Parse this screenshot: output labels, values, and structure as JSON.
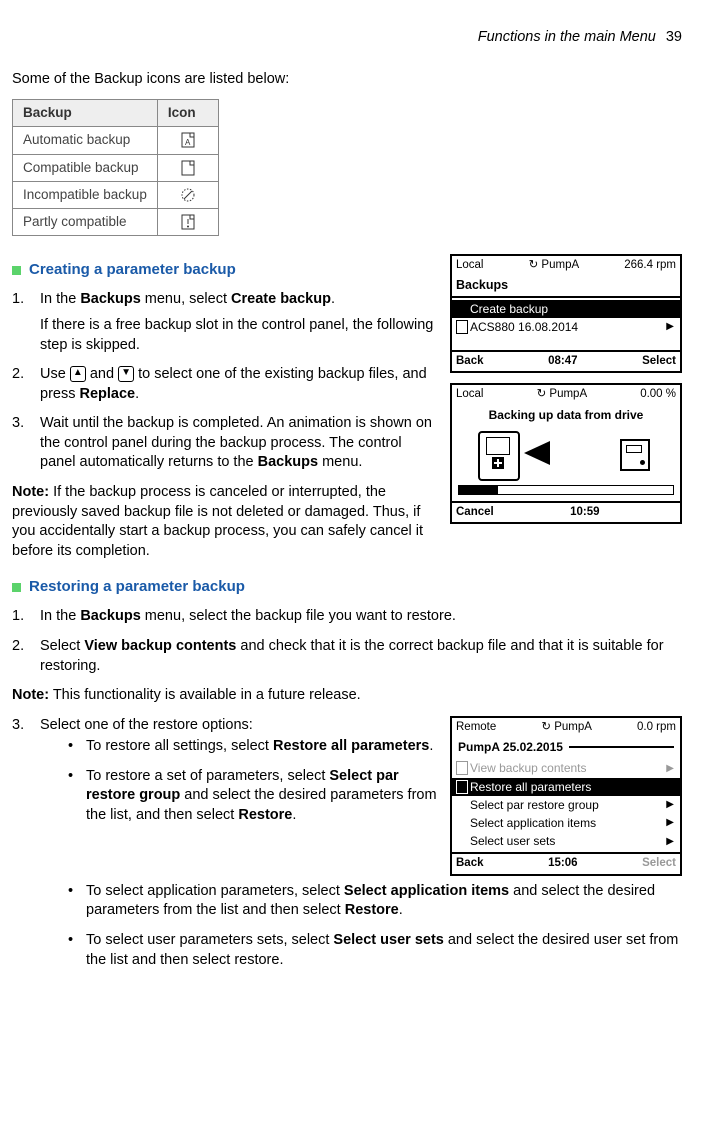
{
  "header": {
    "title": "Functions in the main Menu",
    "page": "39"
  },
  "intro": "Some of the Backup icons are listed below:",
  "icon_table": {
    "headers": [
      "Backup",
      "Icon"
    ],
    "rows": [
      {
        "label": "Automatic backup",
        "icon": "doc-a-icon"
      },
      {
        "label": "Compatible backup",
        "icon": "doc-blank-icon"
      },
      {
        "label": "Incompatible backup",
        "icon": "doc-crossed-icon"
      },
      {
        "label": "Partly compatible",
        "icon": "doc-exclaim-icon"
      }
    ]
  },
  "section1": {
    "title": "Creating a parameter backup",
    "step1_a": "In the ",
    "step1_b": "Backups",
    "step1_c": " menu, select ",
    "step1_d": "Create backup",
    "step1_e": ".",
    "step1_p2": "If there is a free backup slot in the control panel, the following step is skipped.",
    "step2_a": "Use ",
    "step2_b": " and ",
    "step2_c": " to select one of the existing backup files, and press ",
    "step2_d": "Replace",
    "step2_e": ".",
    "step3_a": "Wait until the backup is completed. An animation is shown on the control panel during the backup process. The control panel automatically returns to the ",
    "step3_b": "Backups",
    "step3_c": " menu.",
    "note1_a": "Note:",
    "note1_b": " If the backup process is canceled or interrupted, the previously saved backup file is not deleted or damaged. Thus, if you accidentally start a backup process, you can safely cancel it before its completion."
  },
  "lcd1": {
    "top_left": "Local",
    "top_mid": "PumpA",
    "top_right": "266.4 rpm",
    "title": "Backups",
    "items": [
      {
        "label": "Create backup",
        "selected": true,
        "icon": false,
        "arrow": false
      },
      {
        "label": "ACS880 16.08.2014",
        "selected": false,
        "icon": true,
        "arrow": true
      }
    ],
    "bot_left": "Back",
    "bot_mid": "08:47",
    "bot_right": "Select"
  },
  "lcd2": {
    "top_left": "Local",
    "top_mid": "PumpA",
    "top_right": "0.00 %",
    "msg": "Backing up data from drive",
    "bot_left": "Cancel",
    "bot_mid": "10:59",
    "bot_right": ""
  },
  "section2": {
    "title": "Restoring a parameter backup",
    "step1_a": "In the ",
    "step1_b": "Backups",
    "step1_c": " menu, select the backup file you want to restore.",
    "step2_a": "Select ",
    "step2_b": "View backup contents",
    "step2_c": " and check that it is the correct backup file and that it is suitable for restoring.",
    "note2_a": "Note:",
    "note2_b": " This functionality is available in a future release.",
    "step3": "Select one of the restore options:",
    "opts": {
      "o1_a": "To restore all settings, select ",
      "o1_b": "Restore all parameters",
      "o1_c": ".",
      "o2_a": "To restore a set of parameters, select ",
      "o2_b": "Select par restore group",
      "o2_c": " and select the desired parameters from the list, and then select ",
      "o2_d": "Restore",
      "o2_e": ".",
      "o3_a": "To select application parameters, select ",
      "o3_b": "Select application items",
      "o3_c": " and select the desired parameters from the list and then select ",
      "o3_d": "Restore",
      "o3_e": ".",
      "o4_a": "To select user parameters sets, select ",
      "o4_b": "Select user sets",
      "o4_c": " and select the desired user set from the list and then select restore."
    }
  },
  "lcd3": {
    "top_left": "Remote",
    "top_mid": "PumpA",
    "top_right": "0.0 rpm",
    "title": "PumpA 25.02.2015",
    "items": [
      {
        "label": "View backup contents",
        "selected": false,
        "icon": true,
        "arrow": true,
        "grey": true
      },
      {
        "label": "Restore all parameters",
        "selected": true,
        "icon": true,
        "arrow": false
      },
      {
        "label": "Select par restore group",
        "selected": false,
        "icon": false,
        "arrow": true
      },
      {
        "label": "Select application items",
        "selected": false,
        "icon": false,
        "arrow": true
      },
      {
        "label": "Select user sets",
        "selected": false,
        "icon": false,
        "arrow": true
      }
    ],
    "bot_left": "Back",
    "bot_mid": "15:06",
    "bot_right": "Select"
  },
  "chart_data": {
    "type": "table",
    "title": "Backup icons",
    "columns": [
      "Backup",
      "Icon"
    ],
    "rows": [
      [
        "Automatic backup",
        "doc-a-icon"
      ],
      [
        "Compatible backup",
        "doc-blank-icon"
      ],
      [
        "Incompatible backup",
        "doc-crossed-icon"
      ],
      [
        "Partly compatible",
        "doc-exclaim-icon"
      ]
    ]
  }
}
